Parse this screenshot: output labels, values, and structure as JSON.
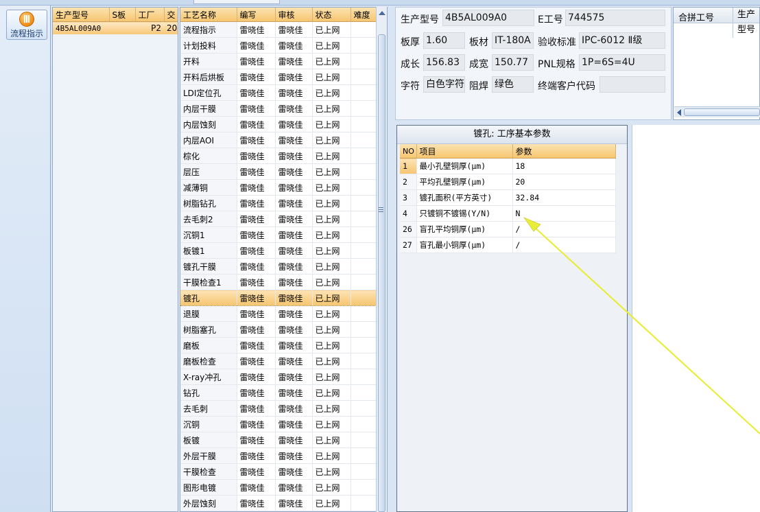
{
  "nav": {
    "flow_button": "流程指示"
  },
  "product_list": {
    "columns": [
      "生产型号",
      "S板",
      "工厂",
      "交"
    ],
    "rows": [
      {
        "model": "4B5AL009A0",
        "s": "",
        "factory": "P2",
        "extra": "20"
      }
    ]
  },
  "process_list": {
    "columns": [
      "工艺名称",
      "编写",
      "审核",
      "状态",
      "难度"
    ],
    "rows": [
      {
        "name": "流程指示",
        "writer": "雷晓佳",
        "reviewer": "雷晓佳",
        "status": "已上网"
      },
      {
        "name": "计划投料",
        "writer": "雷晓佳",
        "reviewer": "雷晓佳",
        "status": "已上网"
      },
      {
        "name": "开料",
        "writer": "雷晓佳",
        "reviewer": "雷晓佳",
        "status": "已上网"
      },
      {
        "name": "开料后烘板",
        "writer": "雷晓佳",
        "reviewer": "雷晓佳",
        "status": "已上网"
      },
      {
        "name": "LDI定位孔",
        "writer": "雷晓佳",
        "reviewer": "雷晓佳",
        "status": "已上网"
      },
      {
        "name": "内层干膜",
        "writer": "雷晓佳",
        "reviewer": "雷晓佳",
        "status": "已上网"
      },
      {
        "name": "内层蚀刻",
        "writer": "雷晓佳",
        "reviewer": "雷晓佳",
        "status": "已上网"
      },
      {
        "name": "内层AOI",
        "writer": "雷晓佳",
        "reviewer": "雷晓佳",
        "status": "已上网"
      },
      {
        "name": "棕化",
        "writer": "雷晓佳",
        "reviewer": "雷晓佳",
        "status": "已上网"
      },
      {
        "name": "层压",
        "writer": "雷晓佳",
        "reviewer": "雷晓佳",
        "status": "已上网"
      },
      {
        "name": "减薄铜",
        "writer": "雷晓佳",
        "reviewer": "雷晓佳",
        "status": "已上网"
      },
      {
        "name": "树脂钻孔",
        "writer": "雷晓佳",
        "reviewer": "雷晓佳",
        "status": "已上网"
      },
      {
        "name": "去毛刺2",
        "writer": "雷晓佳",
        "reviewer": "雷晓佳",
        "status": "已上网"
      },
      {
        "name": "沉铜1",
        "writer": "雷晓佳",
        "reviewer": "雷晓佳",
        "status": "已上网"
      },
      {
        "name": "板镀1",
        "writer": "雷晓佳",
        "reviewer": "雷晓佳",
        "status": "已上网"
      },
      {
        "name": "镀孔干膜",
        "writer": "雷晓佳",
        "reviewer": "雷晓佳",
        "status": "已上网"
      },
      {
        "name": "干膜检查1",
        "writer": "雷晓佳",
        "reviewer": "雷晓佳",
        "status": "已上网"
      },
      {
        "name": "镀孔",
        "writer": "雷晓佳",
        "reviewer": "雷晓佳",
        "status": "已上网"
      },
      {
        "name": "退膜",
        "writer": "雷晓佳",
        "reviewer": "雷晓佳",
        "status": "已上网"
      },
      {
        "name": "树脂塞孔",
        "writer": "雷晓佳",
        "reviewer": "雷晓佳",
        "status": "已上网"
      },
      {
        "name": "磨板",
        "writer": "雷晓佳",
        "reviewer": "雷晓佳",
        "status": "已上网"
      },
      {
        "name": "磨板检查",
        "writer": "雷晓佳",
        "reviewer": "雷晓佳",
        "status": "已上网"
      },
      {
        "name": "X-ray冲孔",
        "writer": "雷晓佳",
        "reviewer": "雷晓佳",
        "status": "已上网"
      },
      {
        "name": "钻孔",
        "writer": "雷晓佳",
        "reviewer": "雷晓佳",
        "status": "已上网"
      },
      {
        "name": "去毛刺",
        "writer": "雷晓佳",
        "reviewer": "雷晓佳",
        "status": "已上网"
      },
      {
        "name": "沉铜",
        "writer": "雷晓佳",
        "reviewer": "雷晓佳",
        "status": "已上网"
      },
      {
        "name": "板镀",
        "writer": "雷晓佳",
        "reviewer": "雷晓佳",
        "status": "已上网"
      },
      {
        "name": "外层干膜",
        "writer": "雷晓佳",
        "reviewer": "雷晓佳",
        "status": "已上网"
      },
      {
        "name": "干膜检查",
        "writer": "雷晓佳",
        "reviewer": "雷晓佳",
        "status": "已上网"
      },
      {
        "name": "图形电镀",
        "writer": "雷晓佳",
        "reviewer": "雷晓佳",
        "status": "已上网"
      },
      {
        "name": "外层蚀刻",
        "writer": "雷晓佳",
        "reviewer": "雷晓佳",
        "status": "已上网"
      }
    ],
    "selected": "镀孔"
  },
  "info": {
    "model_label": "生产型号",
    "model_value": "4B5AL009A0",
    "e_label": "E工号",
    "e_value": "744575",
    "thickness_label": "板厚",
    "thickness_value": "1.60",
    "material_label": "板材",
    "material_value": "IT-180A",
    "standard_label": "验收标准",
    "standard_value": "IPC-6012 Ⅱ级",
    "length_label": "成长",
    "length_value": "156.83",
    "width_label": "成宽",
    "width_value": "150.77",
    "pnl_label": "PNL规格",
    "pnl_value": "1P=6S=4U",
    "legend_label": "字符",
    "legend_value": "白色字符",
    "mask_label": "阻焊",
    "mask_value": "绿色",
    "customer_label": "终端客户代码",
    "customer_value": ""
  },
  "combined": {
    "columns": [
      "合拼工号",
      "生产型号"
    ]
  },
  "params": {
    "title": "镀孔: 工序基本参数",
    "columns": [
      "NO",
      "项目",
      "参数"
    ],
    "rows": [
      {
        "no": "1",
        "item": "最小孔壁铜厚(μm)",
        "value": "18"
      },
      {
        "no": "2",
        "item": "平均孔壁铜厚(μm)",
        "value": "20"
      },
      {
        "no": "3",
        "item": "镀孔面积(平方英寸)",
        "value": "32.84"
      },
      {
        "no": "4",
        "item": "只镀铜不镀锡(Y/N)",
        "value": "N"
      },
      {
        "no": "26",
        "item": "盲孔平均铜厚(μm)",
        "value": "/"
      },
      {
        "no": "27",
        "item": "盲孔最小铜厚(μm)",
        "value": "/"
      }
    ]
  },
  "colors": {
    "selection": "#f7c56e",
    "header": "#f6c66f",
    "annotation_arrow": "#e8ec3a"
  }
}
